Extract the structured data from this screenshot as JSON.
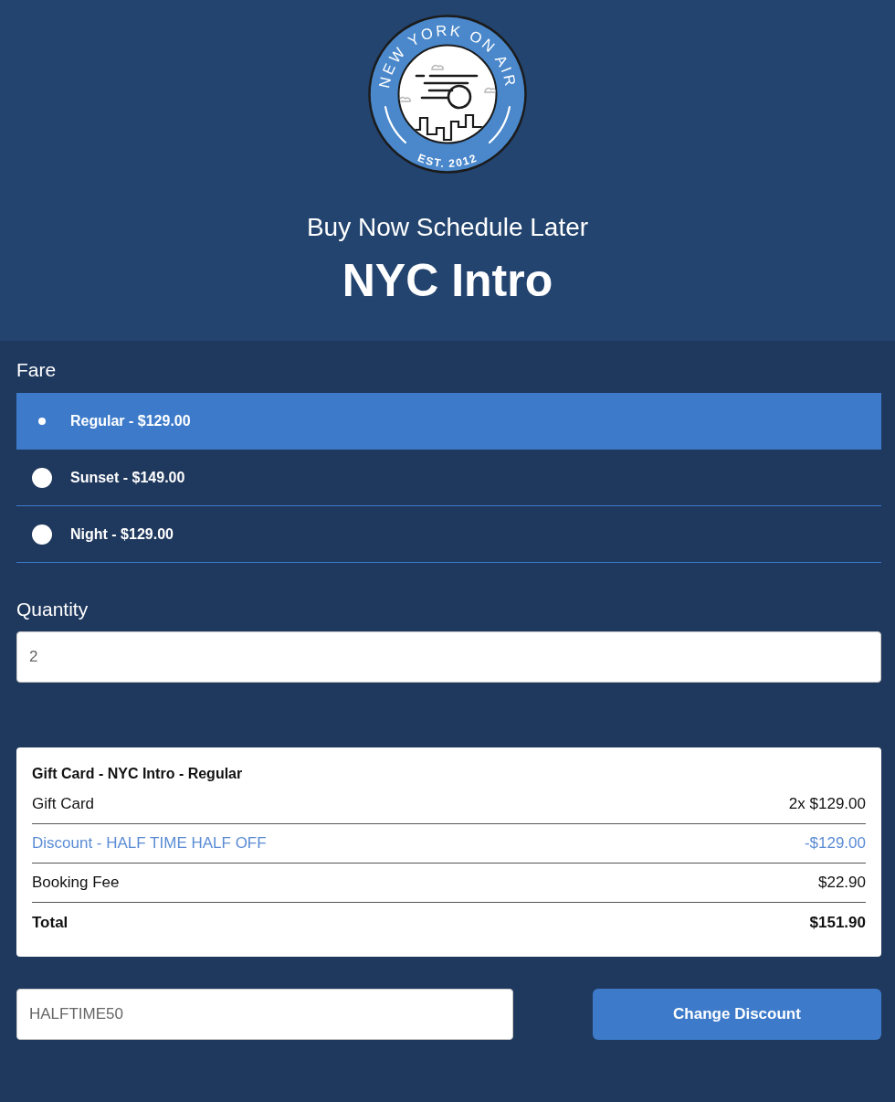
{
  "header": {
    "logo": {
      "name": "NEW YORK ON AIR",
      "established": "EST. 2012"
    },
    "subtitle": "Buy Now Schedule Later",
    "title": "NYC Intro"
  },
  "fare": {
    "label": "Fare",
    "options": [
      {
        "label": "Regular - $129.00",
        "selected": true
      },
      {
        "label": "Sunset - $149.00",
        "selected": false
      },
      {
        "label": "Night - $129.00",
        "selected": false
      }
    ]
  },
  "quantity": {
    "label": "Quantity",
    "value": "2"
  },
  "summary": {
    "title": "Gift Card - NYC Intro - Regular",
    "rows": [
      {
        "kind": "item",
        "label": "Gift Card",
        "amount": "2x $129.00"
      },
      {
        "kind": "discount",
        "label": "Discount - HALF TIME HALF OFF",
        "amount": "-$129.00"
      },
      {
        "kind": "item",
        "label": "Booking Fee",
        "amount": "$22.90"
      },
      {
        "kind": "total",
        "label": "Total",
        "amount": "$151.90"
      }
    ]
  },
  "discount": {
    "value": "HALFTIME50",
    "button": "Change Discount"
  }
}
